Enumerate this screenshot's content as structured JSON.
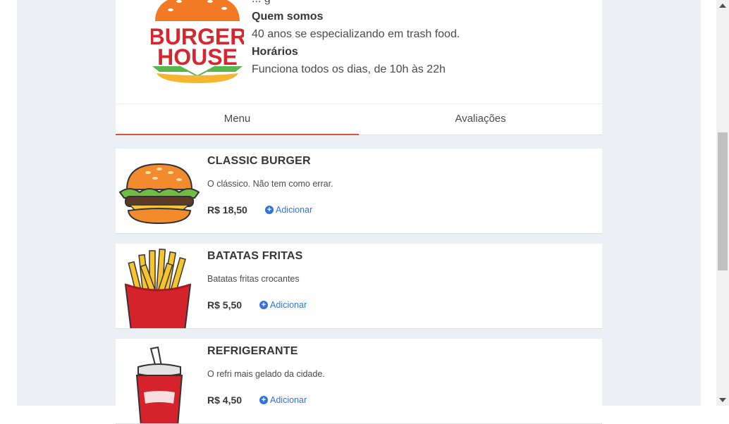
{
  "restaurant": {
    "logo_line1": "BURGER",
    "logo_line2": "HOUSE",
    "partial_line": "... g",
    "about_heading": "Quem somos",
    "about_text": "40 anos se especializando em trash food.",
    "hours_heading": "Horários",
    "hours_text": "Funciona todos os dias, de 10h às 22h"
  },
  "tabs": [
    {
      "label": "Menu",
      "active": true
    },
    {
      "label": "Avaliações",
      "active": false
    }
  ],
  "menu": [
    {
      "name": "CLASSIC BURGER",
      "description": "O clássico. Não tem como errar.",
      "price": "R$ 18,50",
      "add_label": "Adicionar",
      "icon": "burger-icon"
    },
    {
      "name": "BATATAS FRITAS",
      "description": "Batatas fritas crocantes",
      "price": "R$ 5,50",
      "add_label": "Adicionar",
      "icon": "fries-icon"
    },
    {
      "name": "REFRIGERANTE",
      "description": "O refri mais gelado da cidade.",
      "price": "R$ 4,50",
      "add_label": "Adicionar",
      "icon": "soda-icon"
    }
  ],
  "colors": {
    "accent": "#e0533a",
    "link": "#3273dc",
    "background": "#eceff3"
  }
}
